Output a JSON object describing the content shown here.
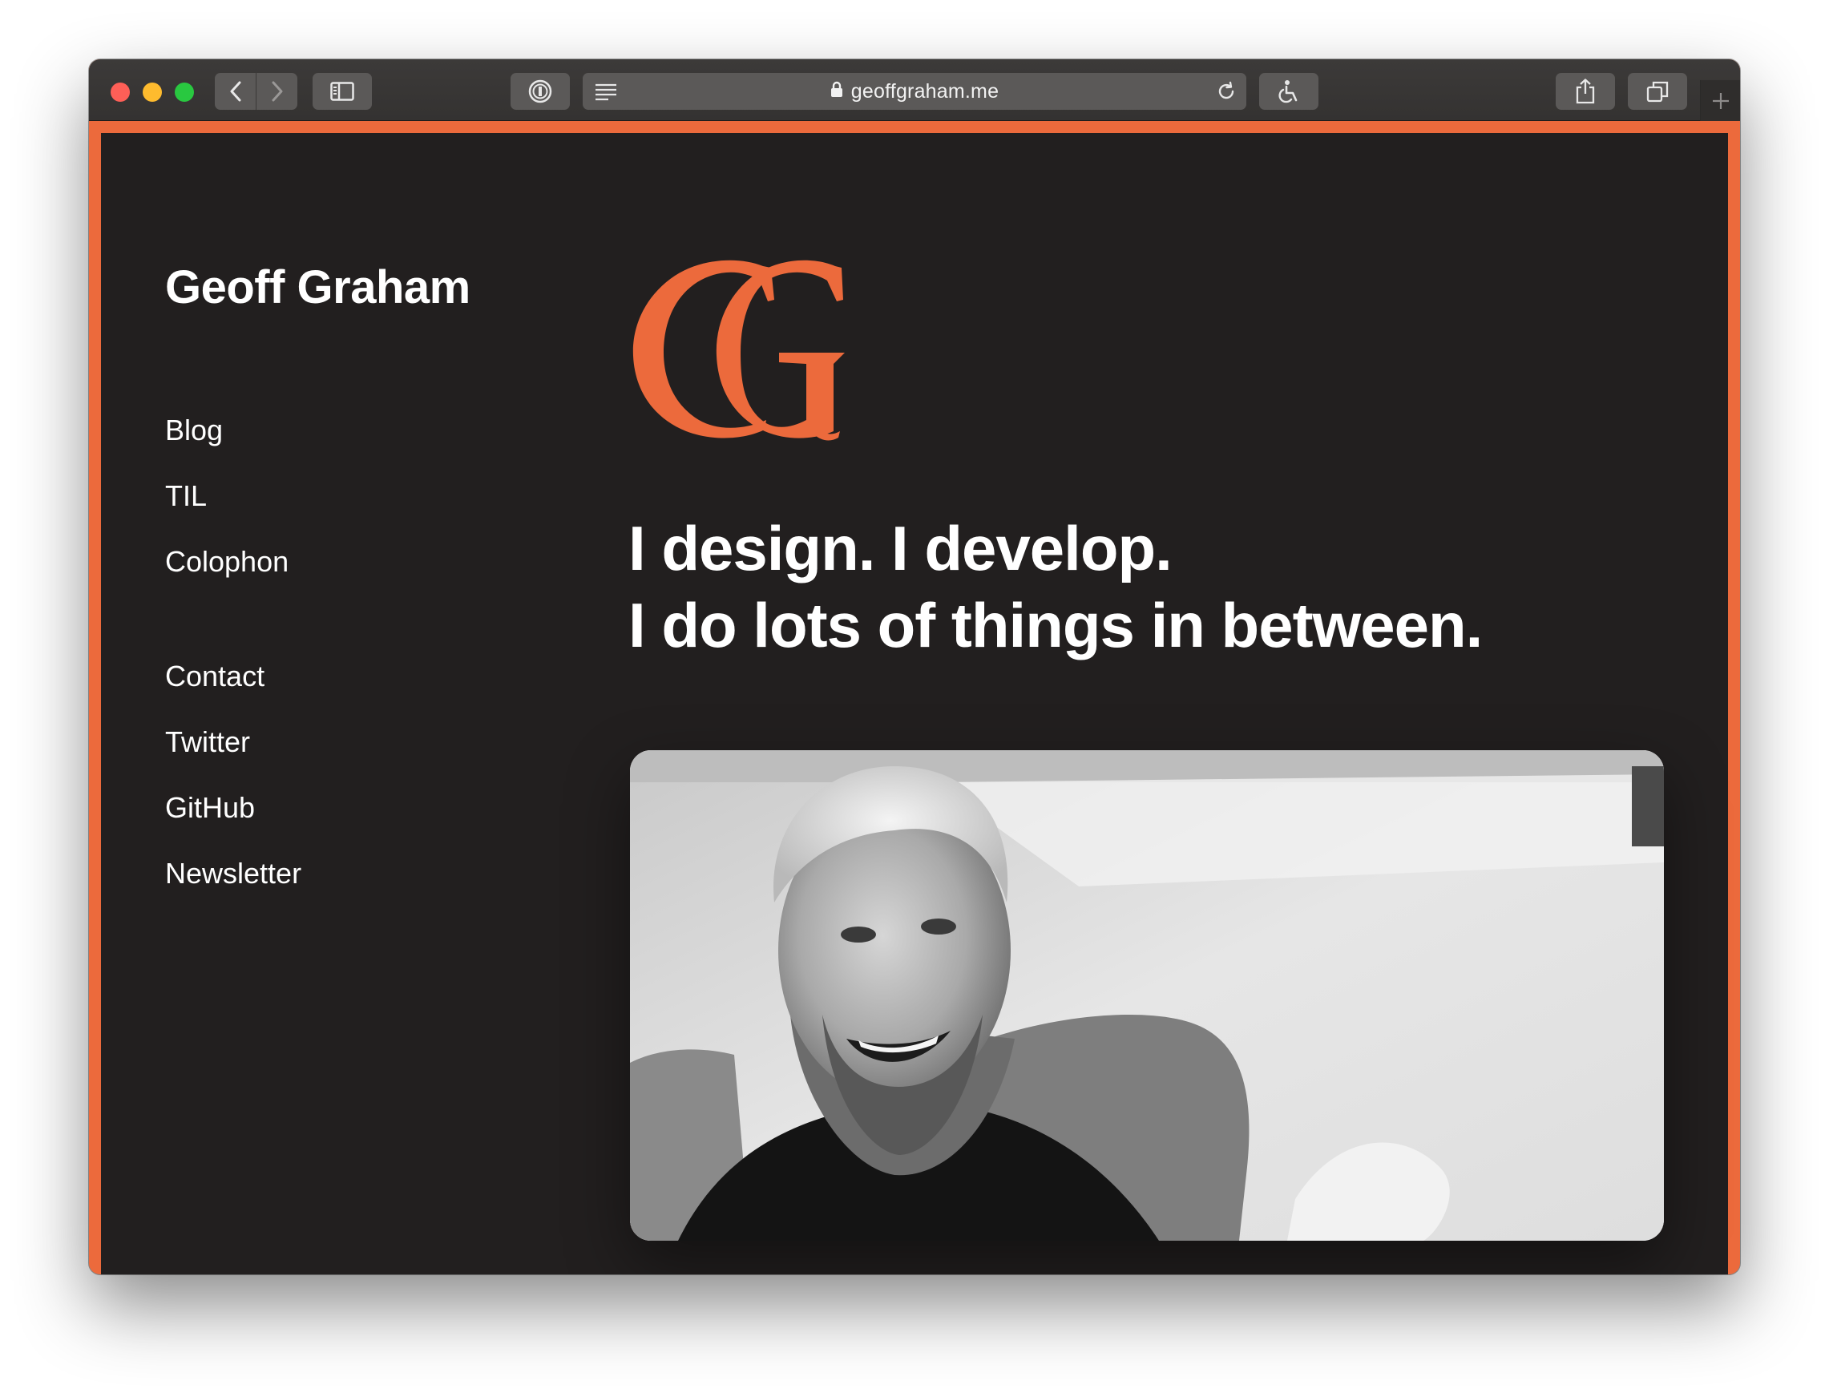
{
  "browser": {
    "url": "geoffgraham.me",
    "accent": "#ec6a3c"
  },
  "site": {
    "title": "Geoff Graham",
    "nav_primary": [
      "Blog",
      "TIL",
      "Colophon"
    ],
    "nav_secondary": [
      "Contact",
      "Twitter",
      "GitHub",
      "Newsletter"
    ],
    "logo_color": "#ec6a3c",
    "headline_line1": "I design. I develop.",
    "headline_line2": "I do lots of things in between.",
    "photo_subject": "smiling-man-portrait"
  }
}
